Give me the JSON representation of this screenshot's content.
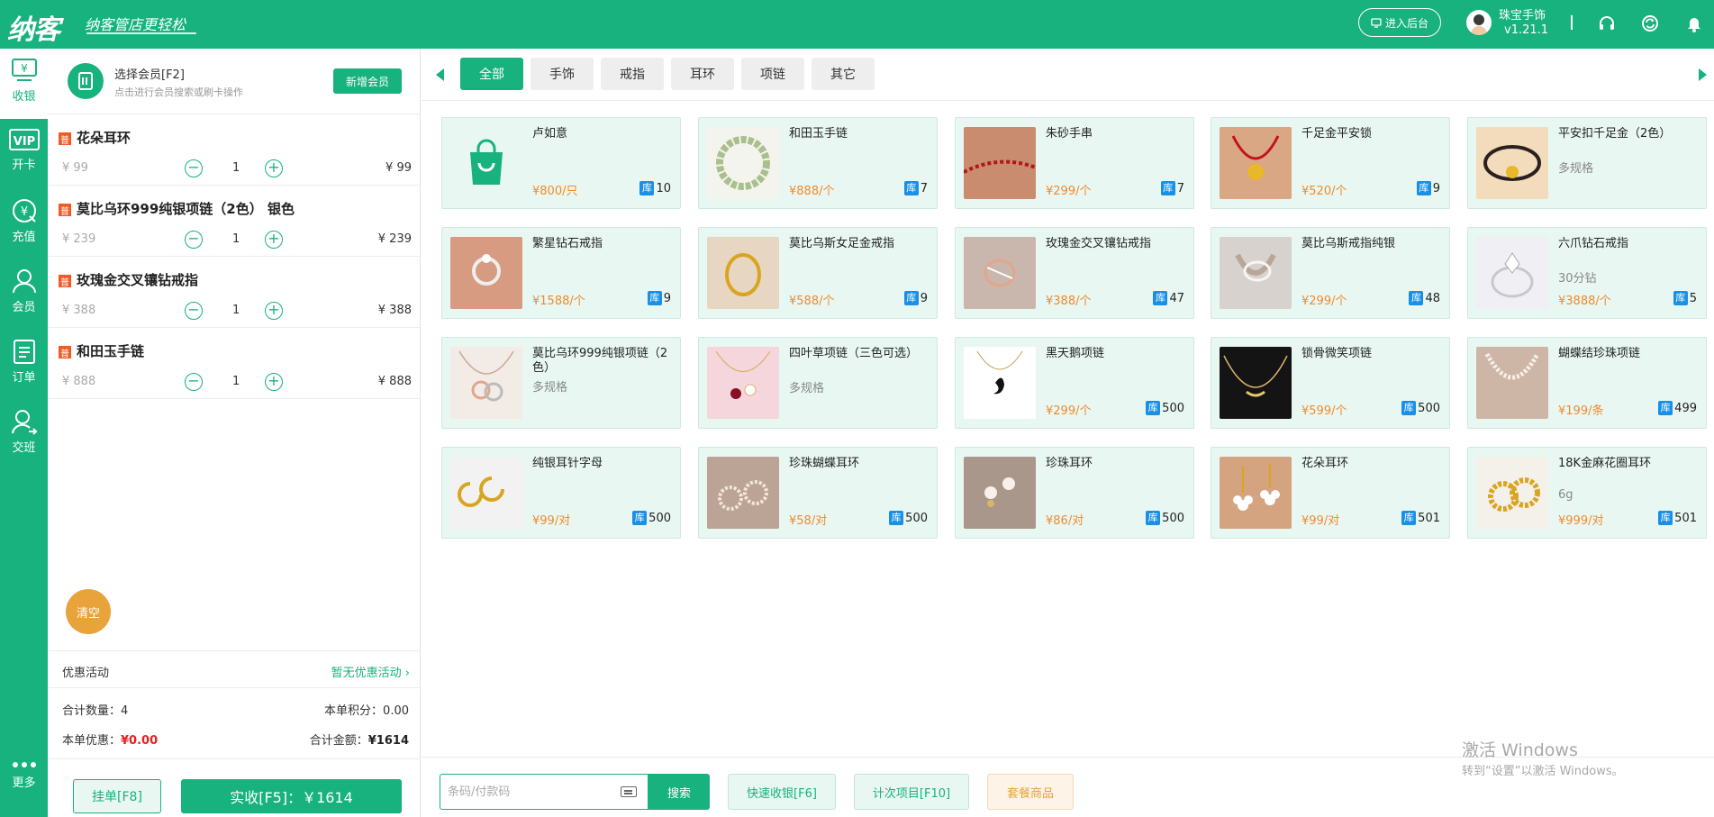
{
  "header": {
    "logo": "纳客",
    "slogan": "纳客管店更轻松",
    "backend_label": "进入后台",
    "store_name": "珠宝手饰",
    "version": "v1.21.1"
  },
  "nav": [
    {
      "label": "收银",
      "icon": "cashier-icon"
    },
    {
      "label": "开卡",
      "icon": "vip-card-icon"
    },
    {
      "label": "充值",
      "icon": "recharge-icon"
    },
    {
      "label": "会员",
      "icon": "member-icon"
    },
    {
      "label": "订单",
      "icon": "order-icon"
    },
    {
      "label": "交班",
      "icon": "shift-icon"
    },
    {
      "label": "更多",
      "icon": "more-icon"
    }
  ],
  "member": {
    "title": "选择会员[F2]",
    "hint": "点击进行会员搜索或刷卡操作",
    "new_button": "新增会员"
  },
  "cart": {
    "items": [
      {
        "badge": "普",
        "name": "花朵耳环",
        "price": "¥ 99",
        "qty": "1",
        "total": "¥ 99"
      },
      {
        "badge": "普",
        "name": "莫比乌环999纯银项链（2色） 银色",
        "price": "¥ 239",
        "qty": "1",
        "total": "¥ 239"
      },
      {
        "badge": "普",
        "name": "玫瑰金交叉镶钻戒指",
        "price": "¥ 388",
        "qty": "1",
        "total": "¥ 388"
      },
      {
        "badge": "普",
        "name": "和田玉手链",
        "price": "¥ 888",
        "qty": "1",
        "total": "¥ 888"
      }
    ],
    "clear_label": "清空",
    "promo_label": "优惠活动",
    "promo_value": "暂无优惠活动 ›",
    "summary": {
      "count_label": "合计数量：",
      "count_value": "4",
      "points_label": "本单积分：",
      "points_value": "0.00",
      "discount_label": "本单优惠：",
      "discount_value": "¥0.00",
      "total_label": "合计金额：",
      "total_value": "¥1614"
    },
    "hold_label": "挂单[F8]",
    "pay_label": "实收[F5]：￥1614"
  },
  "categories": [
    "全部",
    "手饰",
    "戒指",
    "耳环",
    "项链",
    "其它"
  ],
  "products": [
    {
      "name": "卢如意",
      "sub": "",
      "price": "¥800/只",
      "stock_tag": "库",
      "stock": "10",
      "img": "bag"
    },
    {
      "name": "和田玉手链",
      "sub": "",
      "price": "¥888/个",
      "stock_tag": "库",
      "stock": "7",
      "img": "jade"
    },
    {
      "name": "朱砂手串",
      "sub": "",
      "price": "¥299/个",
      "stock_tag": "库",
      "stock": "7",
      "img": "cinnabar"
    },
    {
      "name": "千足金平安锁",
      "sub": "",
      "price": "¥520/个",
      "stock_tag": "库",
      "stock": "9",
      "img": "lock"
    },
    {
      "name": "平安扣千足金（2色）",
      "sub": "多规格",
      "price": "",
      "stock_tag": "",
      "stock": "",
      "img": "cord"
    },
    {
      "name": "繁星钻石戒指",
      "sub": "",
      "price": "¥1588/个",
      "stock_tag": "库",
      "stock": "9",
      "img": "ring1"
    },
    {
      "name": "莫比乌斯女足金戒指",
      "sub": "",
      "price": "¥588/个",
      "stock_tag": "库",
      "stock": "9",
      "img": "goldring"
    },
    {
      "name": "玫瑰金交叉镶钻戒指",
      "sub": "",
      "price": "¥388/个",
      "stock_tag": "库",
      "stock": "47",
      "img": "rosering"
    },
    {
      "name": "莫比乌斯戒指纯银",
      "sub": "",
      "price": "¥299/个",
      "stock_tag": "库",
      "stock": "48",
      "img": "silverring"
    },
    {
      "name": "六爪钻石戒指",
      "sub": "30分钻",
      "price": "¥3888/个",
      "stock_tag": "库",
      "stock": "5",
      "img": "diamond"
    },
    {
      "name": "莫比乌环999纯银项链（2色）",
      "sub": "多规格",
      "price": "",
      "stock_tag": "",
      "stock": "",
      "img": "necklace1"
    },
    {
      "name": "四叶草项链（三色可选）",
      "sub": "多规格",
      "price": "",
      "stock_tag": "",
      "stock": "",
      "img": "clover"
    },
    {
      "name": "黑天鹅项链",
      "sub": "",
      "price": "¥299/个",
      "stock_tag": "库",
      "stock": "500",
      "img": "swan"
    },
    {
      "name": "锁骨微笑项链",
      "sub": "",
      "price": "¥599/个",
      "stock_tag": "库",
      "stock": "500",
      "img": "smile"
    },
    {
      "name": "蝴蝶结珍珠项链",
      "sub": "",
      "price": "¥199/条",
      "stock_tag": "库",
      "stock": "499",
      "img": "pearl"
    },
    {
      "name": "纯银耳针字母",
      "sub": "",
      "price": "¥99/对",
      "stock_tag": "库",
      "stock": "500",
      "img": "hoops"
    },
    {
      "name": "珍珠蝴蝶耳环",
      "sub": "",
      "price": "¥58/对",
      "stock_tag": "库",
      "stock": "500",
      "img": "bow"
    },
    {
      "name": "珍珠耳环",
      "sub": "",
      "price": "¥86/对",
      "stock_tag": "库",
      "stock": "500",
      "img": "pearlstud"
    },
    {
      "name": "花朵耳环",
      "sub": "",
      "price": "¥99/对",
      "stock_tag": "库",
      "stock": "501",
      "img": "flower"
    },
    {
      "name": "18K金麻花圈耳环",
      "sub": "6g",
      "price": "¥999/对",
      "stock_tag": "库",
      "stock": "501",
      "img": "twist"
    }
  ],
  "toolbar": {
    "search_placeholder": "条码/付款码",
    "search_label": "搜索",
    "quick_label": "快速收银[F6]",
    "count_label": "计次项目[F10]",
    "combo_label": "套餐商品"
  },
  "watermark": {
    "line1": "激活 Windows",
    "line2": "转到“设置”以激活 Windows。"
  },
  "colors": {
    "brand": "#17b27e",
    "price": "#f08a2e",
    "discount": "#e52020",
    "badge": "#ef5b25",
    "stock_tag": "#1a8fe6"
  }
}
